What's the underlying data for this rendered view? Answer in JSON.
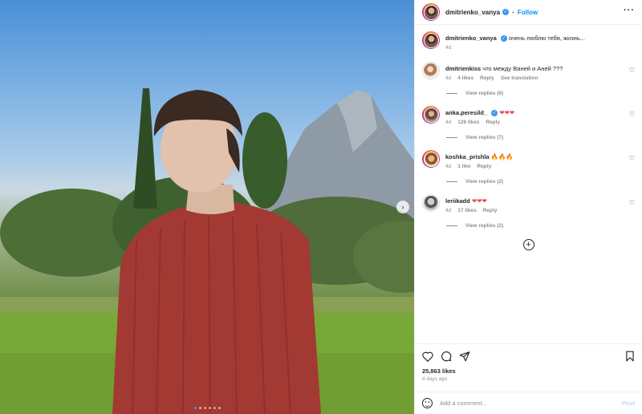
{
  "post": {
    "author": "dmitrienko_vanya",
    "follow_label": "Follow",
    "caption": "очень люблю тебя, жизнь...",
    "caption_time": "4d",
    "photo_count": 6,
    "active_photo": 1
  },
  "comments": [
    {
      "user": "dmitrienkiss",
      "text": "что между Ваней и Аней ???",
      "time": "4d",
      "likes": "4 likes",
      "reply": "Reply",
      "extra": "See translation",
      "replies": "View replies (6)",
      "verified": false
    },
    {
      "user": "anka.peresild_",
      "text": "❤❤❤",
      "time": "4d",
      "likes": "126 likes",
      "reply": "Reply",
      "replies": "View replies (7)",
      "verified": true
    },
    {
      "user": "koshka_prishla",
      "text": "🔥🔥🔥",
      "time": "4d",
      "likes": "1 like",
      "reply": "Reply",
      "replies": "View replies (2)",
      "verified": false
    },
    {
      "user": "leriikadd",
      "text": "❤❤❤",
      "time": "4d",
      "likes": "17 likes",
      "reply": "Reply",
      "replies": "View replies (2)",
      "verified": false
    }
  ],
  "footer": {
    "likes": "25,863 likes",
    "ago": "4 days ago",
    "comment_placeholder": "Add a comment...",
    "post_label": "Post"
  },
  "icons": {
    "more": "more-icon",
    "verified": "verified-icon",
    "heart": "heart-icon",
    "comment": "comment-icon",
    "share": "share-icon",
    "save": "bookmark-icon",
    "emoji": "emoji-icon",
    "add": "plus-icon",
    "next": "chevron-right-icon"
  },
  "colors": {
    "accent": "#0095f6",
    "verified": "#3897f0",
    "heart_red": "#ed4956"
  }
}
